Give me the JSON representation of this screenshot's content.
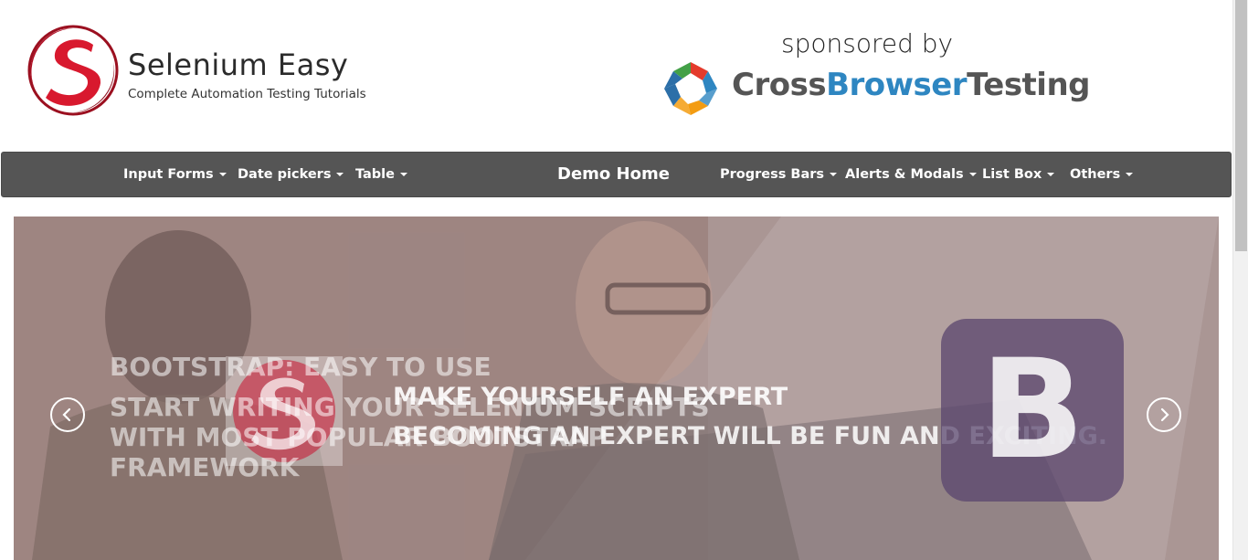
{
  "header": {
    "brand_title": "Selenium Easy",
    "brand_tagline": "Complete Automation Testing Tutorials",
    "sponsored_text": "sponsored by",
    "sponsor_logo": {
      "part1": "Cross",
      "part2": "Browser",
      "part3": "Testing"
    }
  },
  "navbar": {
    "items_left": [
      {
        "label": "Input Forms"
      },
      {
        "label": "Date pickers"
      },
      {
        "label": "Table"
      }
    ],
    "brand": "Demo Home",
    "items_right": [
      {
        "label": "Progress Bars"
      },
      {
        "label": "Alerts & Modals"
      },
      {
        "label": "List Box"
      },
      {
        "label": "Others"
      }
    ]
  },
  "carousel": {
    "slide1": {
      "title": "BOOTSTRAP: EASY TO USE",
      "body": "START WRITING YOUR SELENIUM SCRIPTS WITH MOST POPULAR BOOTSTRAP FRAMEWORK"
    },
    "slide2": {
      "title": "MAKE YOURSELF AN EXPERT",
      "body": "BECOMING AN EXPERT WILL BE FUN AND EXCITING."
    },
    "bootstrap_letter": "B",
    "prev_icon": "chevron-left-icon",
    "next_icon": "chevron-right-icon"
  },
  "colors": {
    "navbar_bg": "#555555",
    "brand_red": "#c8102e",
    "sponsor_blue": "#2e86c1"
  }
}
